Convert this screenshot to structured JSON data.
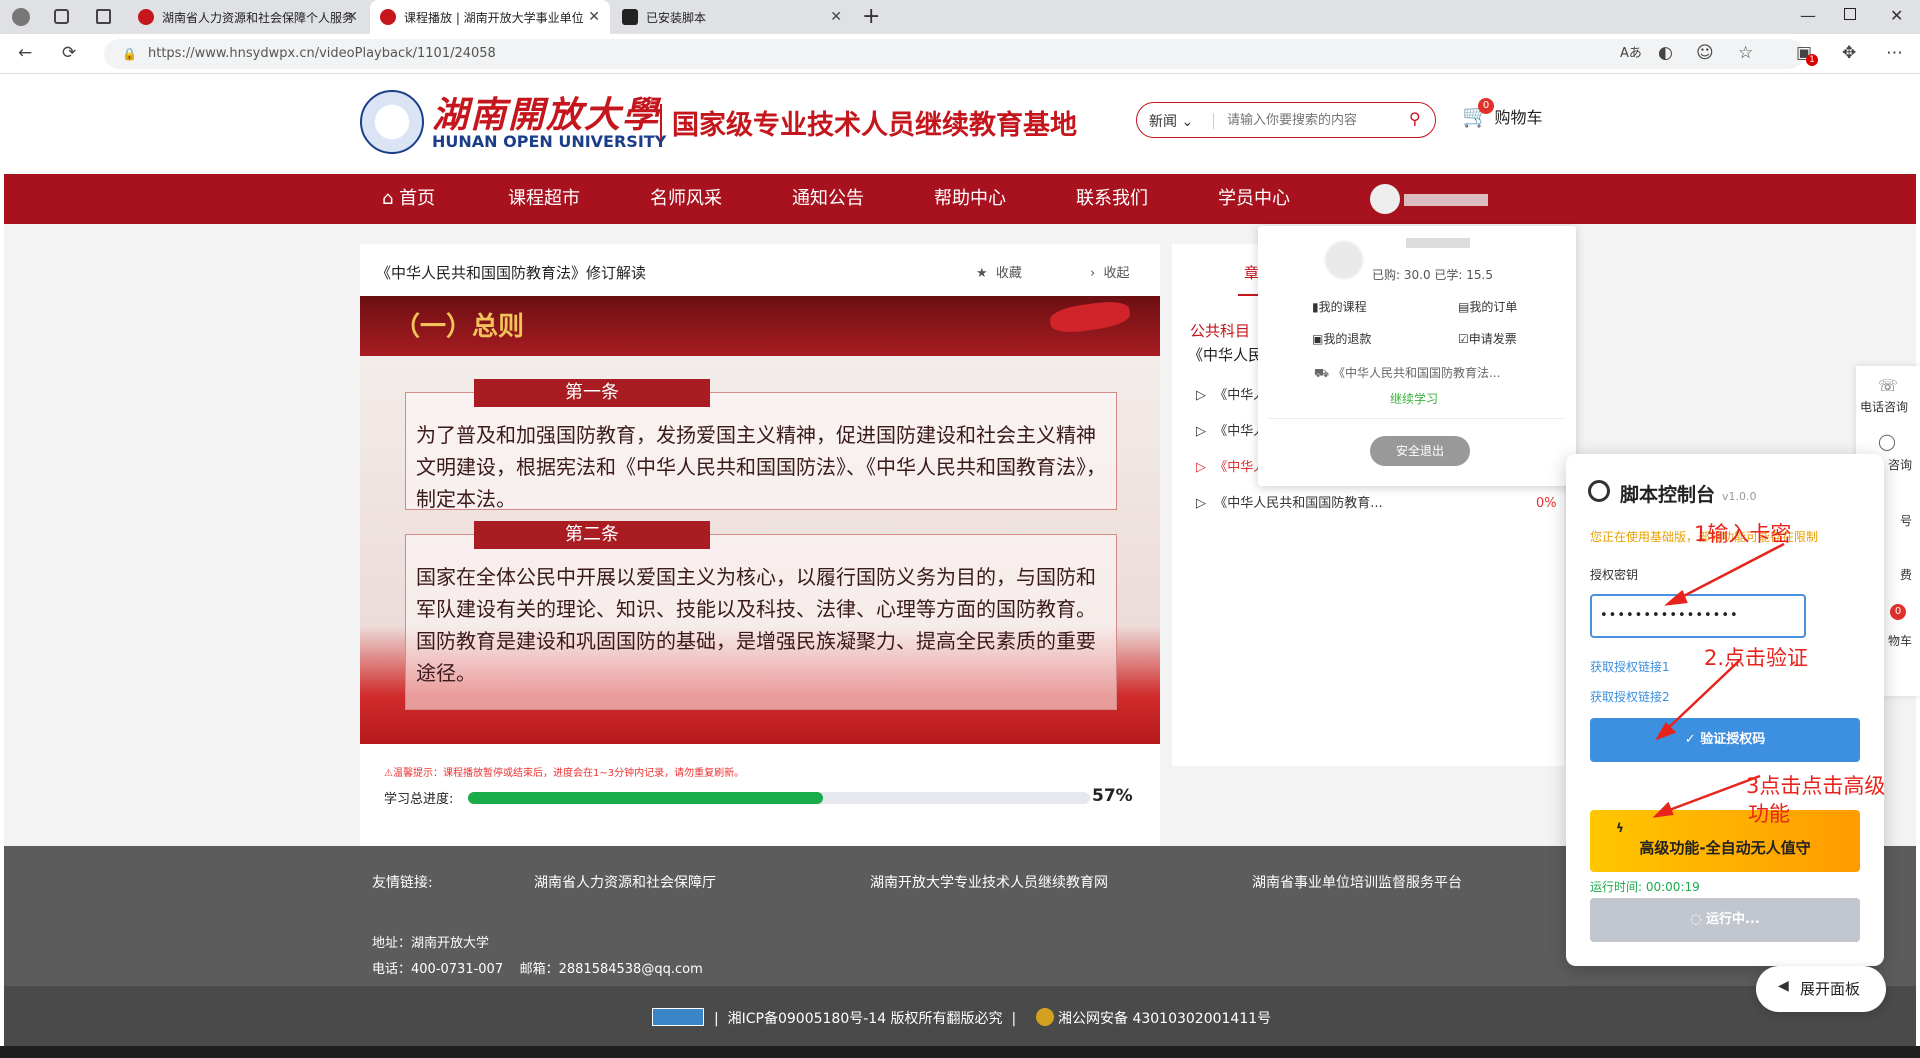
{
  "browser": {
    "tabs": [
      {
        "title": "湖南省人力资源和社会保障个人服务",
        "active": false
      },
      {
        "title": "课程播放 | 湖南开放大学事业单位",
        "active": true
      },
      {
        "title": "已安装脚本",
        "active": false
      }
    ],
    "url": "https://www.hnsydwpx.cn/videoPlayback/1101/24058",
    "ext_badge": "1"
  },
  "header": {
    "logo_cn": "湖南開放大學",
    "logo_en": "HUNAN OPEN UNIVERSITY",
    "slogan": "国家级专业技术人员继续教育基地",
    "search_category": "新闻",
    "search_placeholder": "请输入你要搜索的内容",
    "cart_label": "购物车",
    "cart_count": "0"
  },
  "nav": {
    "items": [
      "首页",
      "课程超市",
      "名师风采",
      "通知公告",
      "帮助中心",
      "联系我们",
      "学员中心"
    ]
  },
  "player": {
    "title": "《中华人民共和国国防教育法》修订解读",
    "favorite": "收藏",
    "collapse": "收起",
    "slide_heading": "（一）总则",
    "article1_title": "第一条",
    "article1_text": "为了普及和加强国防教育，发扬爱国主义精神，促进国防建设和社会主义精神文明建设，根据宪法和《中华人民共和国国防法》、《中华人民共和国教育法》，制定本法。",
    "article2_title": "第二条",
    "article2_text1": "国家在全体公民中开展以爱国主义为核心，以履行国防义务为目的，与国防和军队建设有关的理论、知识、技能以及科技、法律、心理等方面的国防教育。",
    "article2_text2": "国防教育是建设和巩固国防的基础，是增强民族凝聚力、提高全民素质的重要途径。",
    "warning": "⚠温馨提示：课程播放暂停或结束后，进度会在1~3分钟内记录，请勿重复刷新。",
    "progress_label": "学习总进度:",
    "progress_value": 0.57,
    "progress_text": "57%"
  },
  "course_panel": {
    "tab": "章",
    "category": "公共科目",
    "course_title": "《中华人民共",
    "items": [
      {
        "title": "《中华人",
        "active": false
      },
      {
        "title": "《中华人",
        "active": false
      },
      {
        "title": "《中华人",
        "active": true
      },
      {
        "title": "《中华人民共和国国防教育...",
        "active": false,
        "progress": "0%"
      }
    ]
  },
  "user_dropdown": {
    "stats": "已购: 30.0 已学: 15.5",
    "links": [
      "我的课程",
      "我的订单",
      "我的退款",
      "申请发票"
    ],
    "recent": "《中华人民共和国国防教育法...",
    "continue": "继续学习",
    "logout": "安全退出"
  },
  "side_float": {
    "items": [
      "电话咨询",
      "咨询",
      "号",
      "费",
      "物车"
    ],
    "cart_badge": "0"
  },
  "script_panel": {
    "title": "脚本控制台",
    "version": "v1.0.0",
    "notice": "您正在使用基础版，部分功能可能存在限制",
    "key_label": "授权密钥",
    "key_value": "••••••••••••••••",
    "link1": "获取授权链接1",
    "link2": "获取授权链接2",
    "verify_button": "验证授权码",
    "advanced_button": "高级功能-全自动无人值守",
    "runtime": "运行时间: 00:00:19",
    "running_button": "运行中..."
  },
  "annotations": {
    "a1": "1输入卡密",
    "a2": "2.点击验证",
    "a3_1": "3点击点击高级",
    "a3_2": "功能"
  },
  "expand_panel": "展开面板",
  "footer": {
    "links_label": "友情链接:",
    "links": [
      "湖南省人力资源和社会保障厅",
      "湖南开放大学专业技术人员继续教育网",
      "湖南省事业单位培训监督服务平台"
    ],
    "address": "地址：湖南开放大学",
    "contact": "电话：400-0731-007    邮箱：2881584538@qq.com",
    "icp": "湘ICP备09005180号-14 版权所有翻版必究",
    "police": "湘公网安备 43010302001411号"
  },
  "colors": {
    "brand_red": "#a8121f",
    "progress_green": "#1aab4a",
    "script_blue": "#3d8fe0",
    "advanced_gold": "#ffb400"
  }
}
